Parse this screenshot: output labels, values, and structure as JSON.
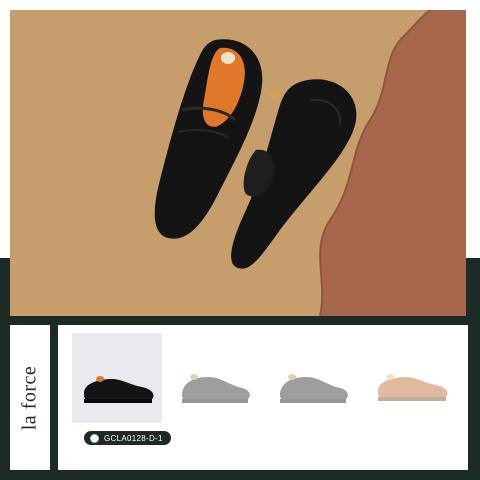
{
  "brand": {
    "name": "la force"
  },
  "product": {
    "selected_variant_code": "GCLA0128-D-1"
  },
  "thumbnails": [
    {
      "icon": "black-loafer-thumbnail",
      "state": "active"
    },
    {
      "icon": "black-oxford-thumbnail",
      "state": "inactive"
    },
    {
      "icon": "black-oxford-thumbnail-2",
      "state": "inactive"
    },
    {
      "icon": "tan-loafer-thumbnail",
      "state": "inactive"
    }
  ],
  "colors": {
    "dark_green": "#1c2b24",
    "backdrop_tan": "#c69e6b",
    "leather_brown": "#a7674c",
    "shoe_black": "#141414",
    "lining_orange": "#e0782a"
  }
}
